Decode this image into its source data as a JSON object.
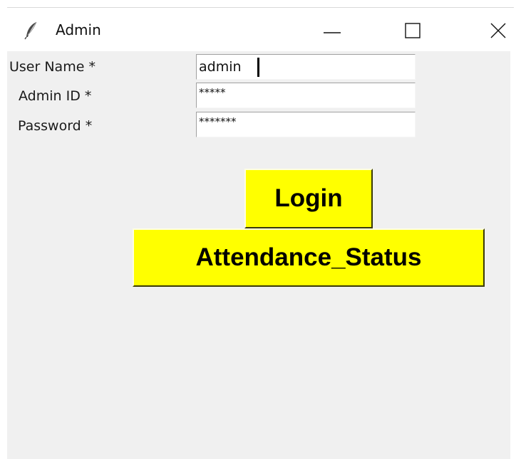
{
  "window": {
    "title": "Admin",
    "icon": "feather-icon",
    "controls": {
      "minimize": "minimize-icon",
      "maximize": "maximize-icon",
      "close": "close-icon"
    }
  },
  "form": {
    "username": {
      "label": "User Name *",
      "value": "admin"
    },
    "admin_id": {
      "label": "Admin ID *",
      "value": "*****"
    },
    "password": {
      "label": "Password *",
      "value": "*******"
    }
  },
  "buttons": {
    "login": "Login",
    "attendance_status": "Attendance_Status"
  },
  "colors": {
    "button_bg": "#ffff00",
    "client_bg": "#f0f0f0"
  }
}
